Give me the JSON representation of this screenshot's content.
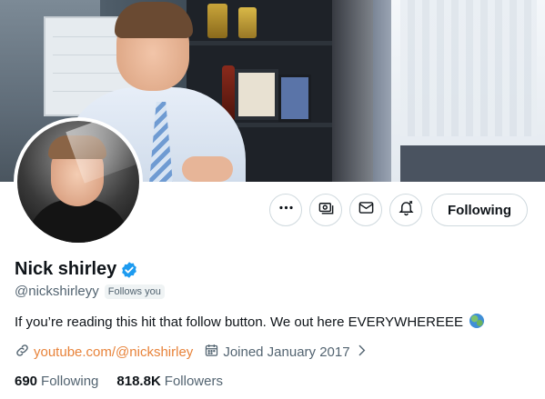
{
  "profile": {
    "name": "Nick shirley",
    "handle": "@nickshirleyy",
    "follows_you": "Follows you",
    "bio": "If you’re reading this hit that follow button. We out here EVERYWHEREEE",
    "bio_emoji": "globe-emoji",
    "website": "youtube.com/@nickshirley",
    "joined": "Joined January 2017",
    "verified": true
  },
  "stats": {
    "following_count": "690",
    "following_label": "Following",
    "followers_count": "818.8K",
    "followers_label": "Followers"
  },
  "actions": {
    "more_icon": "more-icon",
    "subscribe_icon": "money-icon",
    "message_icon": "mail-icon",
    "notify_icon": "bell-icon",
    "follow_label": "Following"
  },
  "colors": {
    "link": "#e8833a",
    "verified": "#1d9bf0",
    "secondary_text": "#536471",
    "primary_text": "#0f1419"
  }
}
